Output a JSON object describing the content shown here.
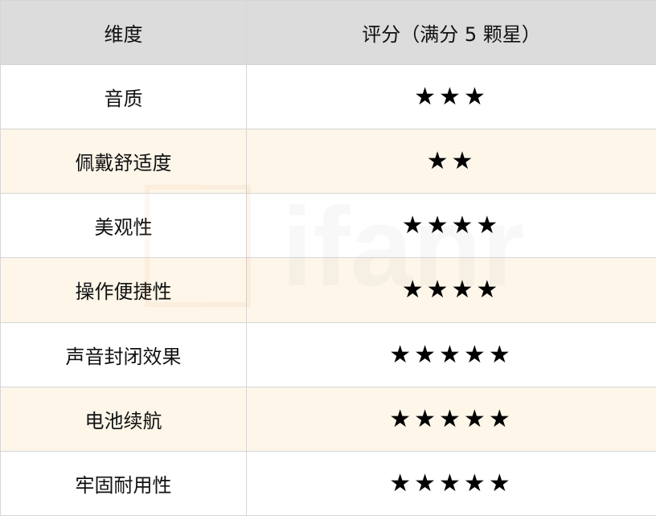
{
  "table": {
    "header": {
      "dimension": "维度",
      "rating": "评分（满分 5 颗星）"
    },
    "rows": [
      {
        "dimension": "音质",
        "stars": 3,
        "stars_text": "★★★"
      },
      {
        "dimension": "佩戴舒适度",
        "stars": 2,
        "stars_text": "★★"
      },
      {
        "dimension": "美观性",
        "stars": 4,
        "stars_text": "★★★★"
      },
      {
        "dimension": "操作便捷性",
        "stars": 4,
        "stars_text": "★★★★"
      },
      {
        "dimension": "声音封闭效果",
        "stars": 5,
        "stars_text": "★★★★★"
      },
      {
        "dimension": "电池续航",
        "stars": 5,
        "stars_text": "★★★★★"
      },
      {
        "dimension": "牢固耐用性",
        "stars": 5,
        "stars_text": "★★★★★"
      }
    ]
  },
  "watermark": {
    "text": "ifanr",
    "logo_color": "#e86a2a"
  },
  "colors": {
    "header_bg": "#dcdcdc",
    "row_alt_bg": "#fdf6e9",
    "border": "#d6d6d6"
  }
}
